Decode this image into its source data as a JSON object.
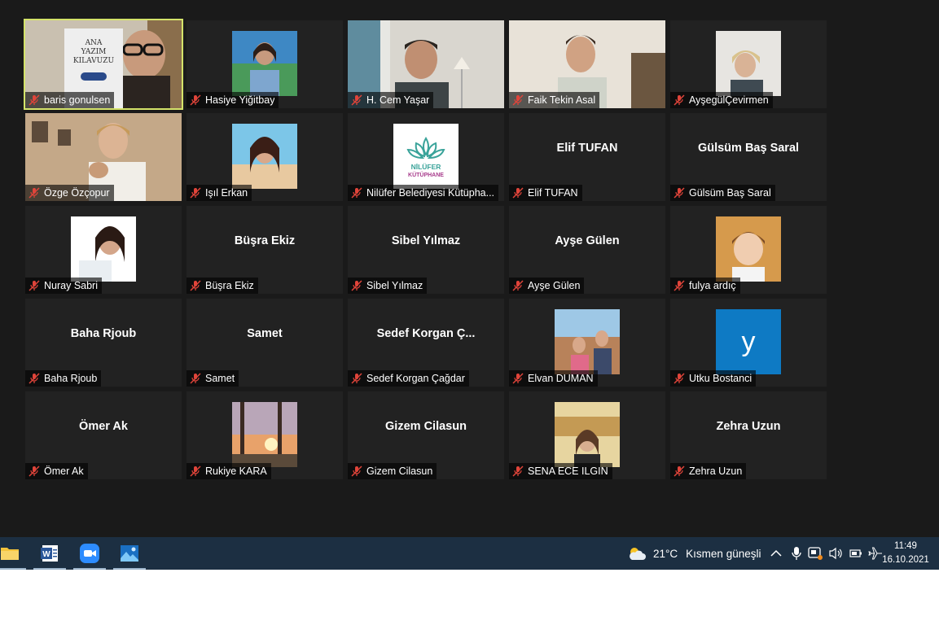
{
  "participants": [
    {
      "name": "baris gonulsen",
      "display": "",
      "kind": "video",
      "active": true,
      "book_line1": "ANA",
      "book_line2": "YAZIM",
      "book_line3": "KILAVUZU"
    },
    {
      "name": "Hasiye Yiğitbay",
      "display": "",
      "kind": "avatar"
    },
    {
      "name": "H. Cem Yaşar",
      "display": "",
      "kind": "video"
    },
    {
      "name": "Faik Tekin Asal",
      "display": "",
      "kind": "video"
    },
    {
      "name": "AyşegülÇevirmen",
      "display": "",
      "kind": "avatar"
    },
    {
      "name": "Özge Özçopur",
      "display": "",
      "kind": "video"
    },
    {
      "name": "Işıl Erkan",
      "display": "",
      "kind": "avatar"
    },
    {
      "name": "Nilüfer Belediyesi Kütüpha...",
      "display": "",
      "kind": "logo",
      "logo_line1": "NİLÜFER",
      "logo_line2": "KÜTÜPHANE"
    },
    {
      "name": "Elif TUFAN",
      "display": "Elif TUFAN",
      "kind": "text"
    },
    {
      "name": "Gülsüm Baş Saral",
      "display": "Gülsüm Baş Saral",
      "kind": "text"
    },
    {
      "name": "Nuray Sabri",
      "display": "",
      "kind": "avatar"
    },
    {
      "name": "Büşra Ekiz",
      "display": "Büşra Ekiz",
      "kind": "text"
    },
    {
      "name": "Sibel Yılmaz",
      "display": "Sibel Yılmaz",
      "kind": "text"
    },
    {
      "name": "Ayşe Gülen",
      "display": "Ayşe Gülen",
      "kind": "text"
    },
    {
      "name": "fulya ardıç",
      "display": "",
      "kind": "avatar"
    },
    {
      "name": "Baha Rjoub",
      "display": "Baha Rjoub",
      "kind": "text"
    },
    {
      "name": "Samet",
      "display": "Samet",
      "kind": "text"
    },
    {
      "name": "Sedef Korgan Çağdar",
      "display": "Sedef  Korgan  Ç...",
      "kind": "text"
    },
    {
      "name": "Elvan DUMAN",
      "display": "",
      "kind": "avatar"
    },
    {
      "name": "Utku Bostanci",
      "display": "",
      "kind": "letter",
      "letter": "y"
    },
    {
      "name": "Ömer Ak",
      "display": "Ömer Ak",
      "kind": "text"
    },
    {
      "name": "Rukiye KARA",
      "display": "",
      "kind": "avatar"
    },
    {
      "name": "Gizem Cilasun",
      "display": "Gizem Cilasun",
      "kind": "text"
    },
    {
      "name": "SENA ECE ILGIN",
      "display": "",
      "kind": "avatar"
    },
    {
      "name": "Zehra Uzun",
      "display": "Zehra Uzun",
      "kind": "text"
    }
  ],
  "taskbar": {
    "apps": [
      {
        "name": "file-explorer",
        "icon": "folder-icon"
      },
      {
        "name": "word",
        "icon": "word-icon",
        "letter": "W"
      },
      {
        "name": "zoom",
        "icon": "zoom-icon"
      },
      {
        "name": "photos",
        "icon": "photos-icon"
      }
    ],
    "weather": {
      "temp": "21°C",
      "desc": "Kısmen güneşli",
      "icon": "partly-sunny-icon"
    },
    "clock": {
      "time": "11:49",
      "date": "16.10.2021"
    }
  },
  "colors": {
    "meeting_bg": "#1a1a1a",
    "tile_bg": "#222222",
    "active_speaker": "#d4e36a",
    "muted_mic": "#e0443a",
    "taskbar_bg": "#1c2f42",
    "utku_tile": "#0e7ac4"
  }
}
